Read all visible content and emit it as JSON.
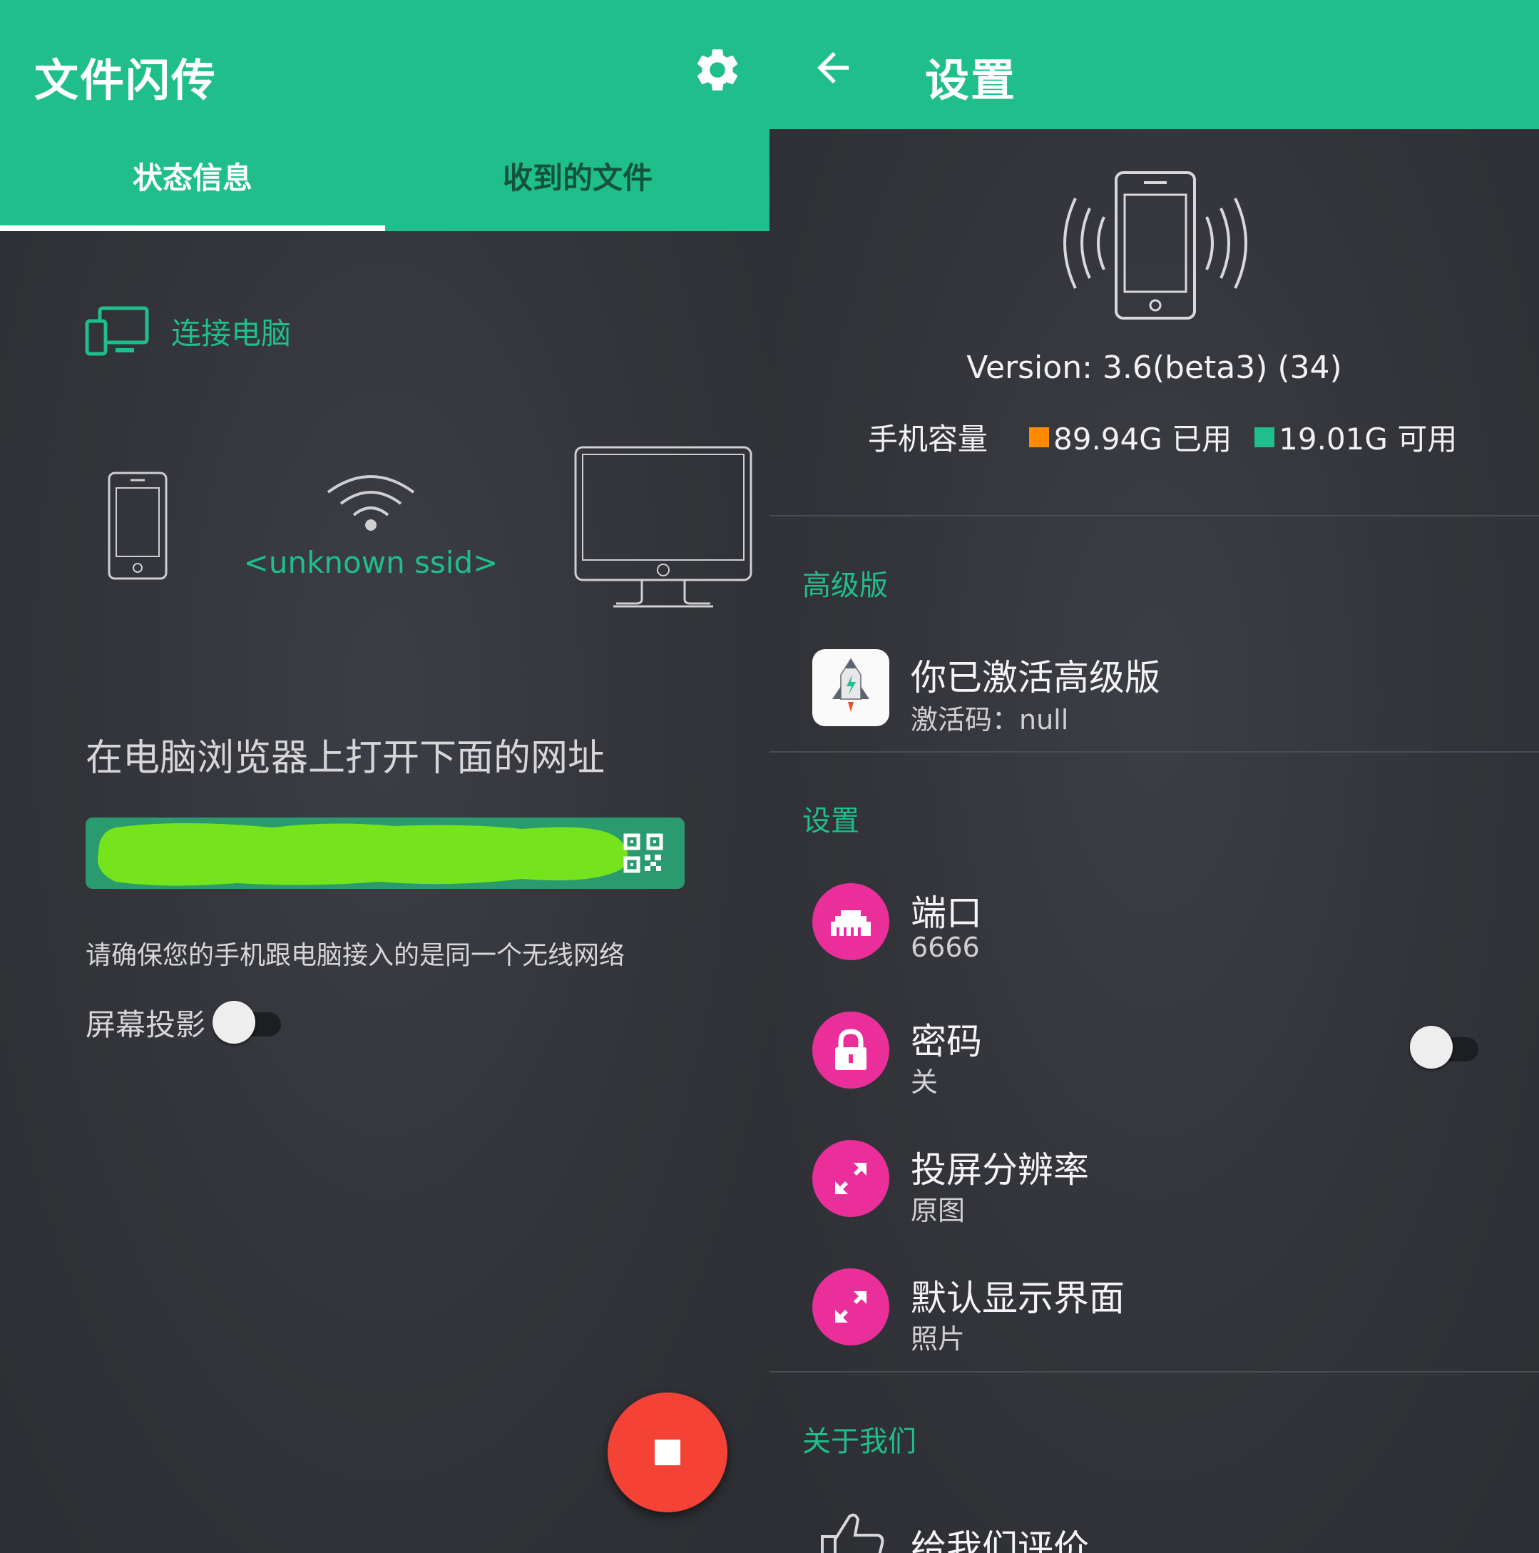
{
  "left": {
    "app_title": "文件闪传",
    "tabs": [
      {
        "label": "状态信息",
        "active": true
      },
      {
        "label": "收到的文件",
        "active": false
      }
    ],
    "section_title": "连接电脑",
    "ssid": "<unknown ssid>",
    "open_url_instruction": "在电脑浏览器上打开下面的网址",
    "url_value": "",
    "same_network_hint": "请确保您的手机跟电脑接入的是同一个无线网络",
    "screen_projection": {
      "label": "屏幕投影",
      "enabled": false
    }
  },
  "right": {
    "title": "设置",
    "version": "Version: 3.6(beta3) (34)",
    "storage": {
      "label": "手机容量",
      "used": "89.94G 已用",
      "free": "19.01G 可用"
    },
    "premium": {
      "category": "高级版",
      "title": "你已激活高级版",
      "subtitle": "激活码：null"
    },
    "settings": {
      "category": "设置",
      "items": [
        {
          "title": "端口",
          "value": "6666",
          "icon": "ethernet-port-icon"
        },
        {
          "title": "密码",
          "value": "关",
          "icon": "lock-icon",
          "toggle": false
        },
        {
          "title": "投屏分辨率",
          "value": "原图",
          "icon": "resize-icon"
        },
        {
          "title": "默认显示界面",
          "value": "照片",
          "icon": "resize-icon"
        }
      ]
    },
    "about": {
      "category": "关于我们",
      "items": [
        {
          "title": "给我们评价",
          "icon": "thumbs-up-icon"
        }
      ]
    }
  },
  "colors": {
    "accent": "#1fbe8b",
    "background": "#323439",
    "icon_pink": "#ea2f9b",
    "fab_red": "#f44336",
    "used_orange": "#ff8c00",
    "redaction_green": "#76e41c"
  }
}
